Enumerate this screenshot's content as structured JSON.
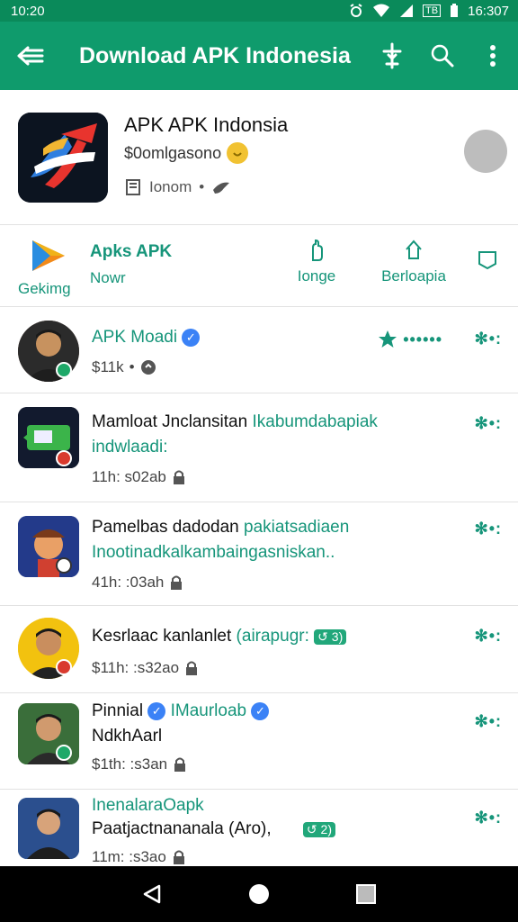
{
  "status": {
    "time_left": "10:20",
    "time_right": "16:307",
    "tag": "TB"
  },
  "appbar": {
    "title": "Download APK Indonesia",
    "icons": [
      "back-arrow-icon",
      "sword-icon",
      "search-icon",
      "overflow-icon"
    ]
  },
  "header": {
    "app_name": "APK APK Indonsia",
    "developer": "$0omlgasono",
    "meta": "Ionom",
    "meta_sep": "•"
  },
  "tabs": {
    "play_label": "Gekimg",
    "text_line1": "Apks APK",
    "text_line2": "Nowr",
    "tab3": "Ionge",
    "tab4": "Berloapia"
  },
  "list": [
    {
      "title": "APK Moadi",
      "meta": "$11k",
      "meta_sep": "•",
      "rating_dots": "••••••",
      "more": "✻•:"
    },
    {
      "title_a": "Mamloat Jnclansitan",
      "title_b": "Ikabumdabapiak",
      "line2": "indwlaadi:",
      "meta": "11h: s02ab",
      "more": "✻•:"
    },
    {
      "title_a": "Pamelbas dadodan",
      "title_b": "pakiatsadiaen",
      "line2": "Inootinadkalkambaingasniskan..",
      "meta": "41h: :03ah",
      "more": "✻•:"
    },
    {
      "title_a": "Kesrlaac kanlanlet",
      "title_b": "(airapugr:",
      "pill": "↺ 3)",
      "meta": "$11h: :s32ao",
      "more": "✻•:"
    },
    {
      "title_a": "Pinnial",
      "title_b": "IMaurloab",
      "line2": "NdkhAarl",
      "meta": "$1th: :s3an",
      "more": "✻•:"
    },
    {
      "title_a": "Inenalara",
      "title_b": "Oapk",
      "line2": "Paatjactnananala (Aro),",
      "pill": "↺ 2)",
      "meta": "11m: :s3ao",
      "more": "✻•:"
    }
  ],
  "colors": {
    "appbar": "#0f9b6c",
    "statusbar": "#0a8a5a",
    "accent": "#16957a",
    "verified": "#3b82f6"
  }
}
